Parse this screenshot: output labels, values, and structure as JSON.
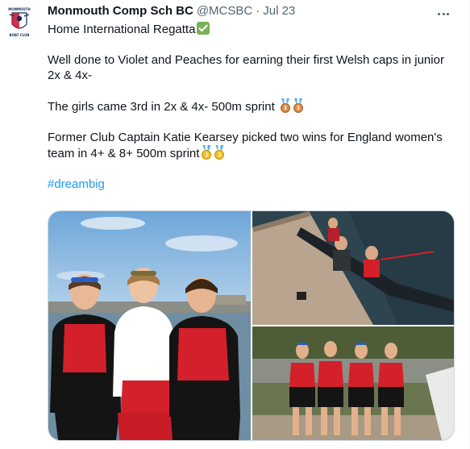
{
  "tweet": {
    "author_name": "Monmouth Comp Sch BC",
    "author_handle": "@MCSBC",
    "separator": "·",
    "date": "Jul 23",
    "lines": {
      "l1": "Home International Regatta",
      "l2": "Well done to Violet and Peaches for earning their first Welsh caps in junior",
      "l3": "2x & 4x-",
      "l4": "The girls came 3rd in 2x & 4x- 500m sprint",
      "l5": "Former Club Captain Katie Kearsey picked two wins for England women's",
      "l6": "team in 4+ & 8+ 500m sprint",
      "hashtag": "#dreambig"
    },
    "emoji": {
      "check": "check-mark-button-icon",
      "bronze": "3rd-place-medal-icon",
      "gold": "1st-place-medal-icon",
      "bronze_number": "3",
      "gold_number": "1"
    },
    "logo": {
      "line1": "MONMOUTH",
      "line2": "BOAT CLUB"
    }
  },
  "colors": {
    "link": "#1d9bf0",
    "secondary_text": "#536471",
    "wales_red": "#d4202b",
    "border": "#cfd9de"
  }
}
